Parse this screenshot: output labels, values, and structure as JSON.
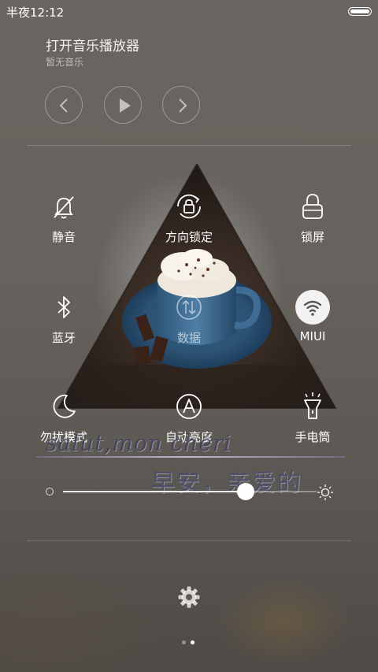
{
  "status_bar": {
    "time": "半夜12:12"
  },
  "music": {
    "title": "打开音乐播放器",
    "subtitle": "暂无音乐"
  },
  "toggles": [
    {
      "id": "mute",
      "label": "静音",
      "icon": "bell-off-icon",
      "active": false
    },
    {
      "id": "rotation-lock",
      "label": "方向锁定",
      "icon": "rotation-lock-icon",
      "active": false
    },
    {
      "id": "lock-screen",
      "label": "锁屏",
      "icon": "lock-icon",
      "active": false
    },
    {
      "id": "bluetooth",
      "label": "蓝牙",
      "icon": "bluetooth-icon",
      "active": false
    },
    {
      "id": "data",
      "label": "数据",
      "icon": "mobile-data-icon",
      "active": false
    },
    {
      "id": "wifi",
      "label": "MIUI",
      "icon": "wifi-icon",
      "active": true
    },
    {
      "id": "dnd",
      "label": "勿扰模式",
      "icon": "moon-icon",
      "active": false
    },
    {
      "id": "auto-brightness",
      "label": "自动亮度",
      "icon": "auto-brightness-icon",
      "active": false
    },
    {
      "id": "flashlight",
      "label": "手电筒",
      "icon": "flashlight-icon",
      "active": false
    }
  ],
  "overlay": {
    "french": "salut,mon chéri",
    "chinese": "早安，亲爱的"
  },
  "brightness": {
    "level": 0.72
  },
  "pager": {
    "pages": 2,
    "current": 2
  },
  "colors": {
    "active_toggle_bg": "#f2f2f2",
    "text": "#ffffff"
  }
}
